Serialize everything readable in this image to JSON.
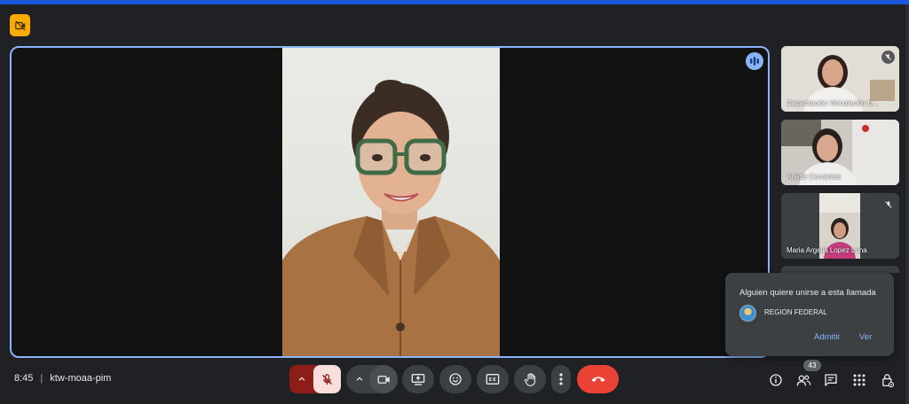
{
  "meeting": {
    "time": "8:45",
    "separator": "|",
    "code": "ktw-moaa-pim"
  },
  "participants": [
    {
      "name": "Capacitación Vinculación U..."
    },
    {
      "name": "Arlette Cervantes"
    },
    {
      "name": "Maria Argelia Lopez Luna"
    }
  ],
  "join_request": {
    "title": "Alguien quiere unirse a esta llamada",
    "requester": "REGION FEDERAL",
    "admit_label": "Admitir",
    "view_label": "Ver"
  },
  "people_count": "43",
  "colors": {
    "accent": "#8ab4f8",
    "end_call": "#ea4335",
    "mic_muted_bg": "#f9dedc",
    "mic_muted_dark": "#8c1d18",
    "recording": "#f9ab00"
  },
  "icons": {
    "recording": "recording-off-icon",
    "speaking": "audio-wave-icon",
    "mic_off": "mic-off-icon",
    "camera": "videocam-icon",
    "present": "present-screen-icon",
    "emoji": "emoji-icon",
    "captions": "captions-icon",
    "hand": "raise-hand-icon",
    "more": "more-vert-icon",
    "end": "call-end-icon",
    "info": "info-icon",
    "people": "people-icon",
    "chat": "chat-icon",
    "activities": "apps-grid-icon",
    "host": "host-controls-lock-icon"
  }
}
